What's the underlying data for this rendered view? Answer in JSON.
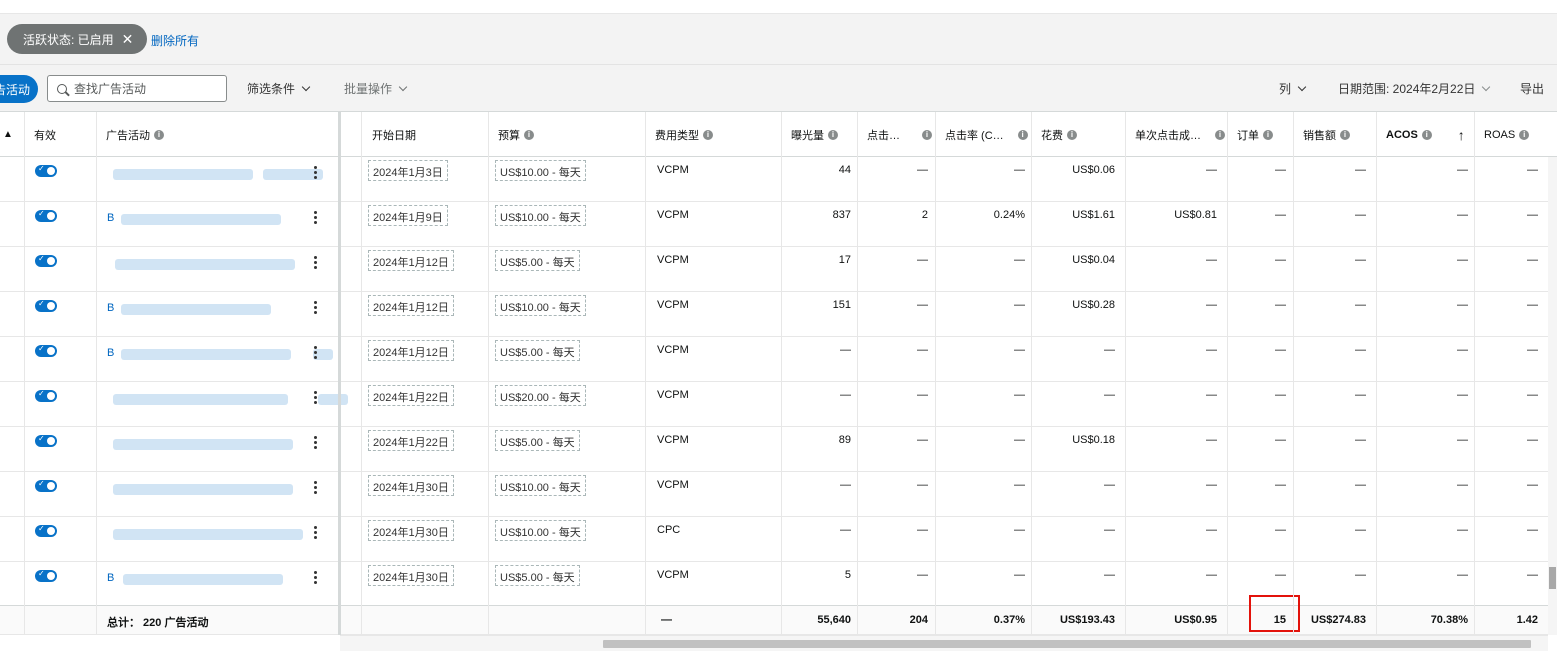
{
  "filter": {
    "chip_label": "活跃状态: 已启用",
    "remove_all": "删除所有"
  },
  "toolbar": {
    "create_label": "告活动",
    "search_placeholder": "查找广告活动",
    "filter_label": "筛选条件",
    "bulk_label": "批量操作",
    "columns_label": "列",
    "date_range": "日期范围: 2024年2月22日",
    "export_label": "导出"
  },
  "headers": {
    "warning": "▲",
    "active": "有效",
    "campaign": "广告活动",
    "start_date": "开始日期",
    "budget": "预算",
    "cost_type": "费用类型",
    "impressions": "曝光量",
    "clicks": "点击…",
    "ctr": "点击率 (C…",
    "spend": "花费",
    "cpc": "单次点击成…",
    "orders": "订单",
    "sales": "销售额",
    "acos": "ACOS",
    "roas": "ROAS"
  },
  "rows": [
    {
      "name": "",
      "start_date": "2024年1月3日",
      "budget": "US$10.00 - 每天",
      "cost_type": "VCPM",
      "impressions": "44",
      "clicks": "—",
      "ctr": "—",
      "spend": "US$0.06",
      "cpc": "—",
      "orders": "—",
      "sales": "—",
      "acos": "—",
      "roas": "—"
    },
    {
      "name": "B",
      "start_date": "2024年1月9日",
      "budget": "US$10.00 - 每天",
      "cost_type": "VCPM",
      "impressions": "837",
      "clicks": "2",
      "ctr": "0.24%",
      "spend": "US$1.61",
      "cpc": "US$0.81",
      "orders": "—",
      "sales": "—",
      "acos": "—",
      "roas": "—"
    },
    {
      "name": "",
      "start_date": "2024年1月12日",
      "budget": "US$5.00 - 每天",
      "cost_type": "VCPM",
      "impressions": "17",
      "clicks": "—",
      "ctr": "—",
      "spend": "US$0.04",
      "cpc": "—",
      "orders": "—",
      "sales": "—",
      "acos": "—",
      "roas": "—"
    },
    {
      "name": "B",
      "start_date": "2024年1月12日",
      "budget": "US$10.00 - 每天",
      "cost_type": "VCPM",
      "impressions": "151",
      "clicks": "—",
      "ctr": "—",
      "spend": "US$0.28",
      "cpc": "—",
      "orders": "—",
      "sales": "—",
      "acos": "—",
      "roas": "—"
    },
    {
      "name": "B",
      "start_date": "2024年1月12日",
      "budget": "US$5.00 - 每天",
      "cost_type": "VCPM",
      "impressions": "—",
      "clicks": "—",
      "ctr": "—",
      "spend": "—",
      "cpc": "—",
      "orders": "—",
      "sales": "—",
      "acos": "—",
      "roas": "—"
    },
    {
      "name": "",
      "start_date": "2024年1月22日",
      "budget": "US$20.00 - 每天",
      "cost_type": "VCPM",
      "impressions": "—",
      "clicks": "—",
      "ctr": "—",
      "spend": "—",
      "cpc": "—",
      "orders": "—",
      "sales": "—",
      "acos": "—",
      "roas": "—"
    },
    {
      "name": "",
      "start_date": "2024年1月22日",
      "budget": "US$5.00 - 每天",
      "cost_type": "VCPM",
      "impressions": "89",
      "clicks": "—",
      "ctr": "—",
      "spend": "US$0.18",
      "cpc": "—",
      "orders": "—",
      "sales": "—",
      "acos": "—",
      "roas": "—"
    },
    {
      "name": "",
      "start_date": "2024年1月30日",
      "budget": "US$10.00 - 每天",
      "cost_type": "VCPM",
      "impressions": "—",
      "clicks": "—",
      "ctr": "—",
      "spend": "—",
      "cpc": "—",
      "orders": "—",
      "sales": "—",
      "acos": "—",
      "roas": "—"
    },
    {
      "name": "",
      "start_date": "2024年1月30日",
      "budget": "US$10.00 - 每天",
      "cost_type": "CPC",
      "impressions": "—",
      "clicks": "—",
      "ctr": "—",
      "spend": "—",
      "cpc": "—",
      "orders": "—",
      "sales": "—",
      "acos": "—",
      "roas": "—"
    },
    {
      "name": "B",
      "start_date": "2024年1月30日",
      "budget": "US$5.00 - 每天",
      "cost_type": "VCPM",
      "impressions": "5",
      "clicks": "—",
      "ctr": "—",
      "spend": "—",
      "cpc": "—",
      "orders": "—",
      "sales": "—",
      "acos": "—",
      "roas": "—"
    }
  ],
  "totals": {
    "label": "总计： 220 广告活动",
    "cost_type": "—",
    "impressions": "55,640",
    "clicks": "204",
    "ctr": "0.37%",
    "spend": "US$193.43",
    "cpc": "US$0.95",
    "orders": "15",
    "sales": "US$274.83",
    "acos": "70.38%",
    "roas": "1.42"
  },
  "colors": {
    "brand_blue": "#0872c8",
    "link": "#0066c0",
    "highlight": "#e3120b"
  }
}
